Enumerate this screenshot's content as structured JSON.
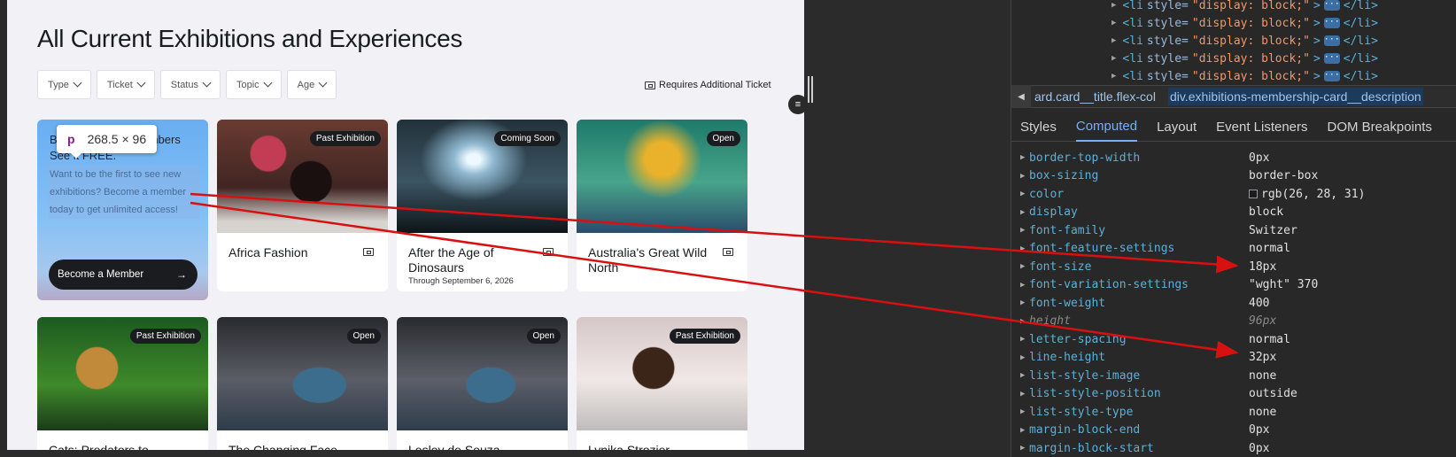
{
  "page": {
    "title": "All Current Exhibitions and Experiences",
    "filters": [
      "Type",
      "Ticket",
      "Status",
      "Topic",
      "Age"
    ],
    "requires_ticket_label": "Requires Additional Ticket"
  },
  "membership": {
    "title": "BE THE FIRST. Members See it FREE.",
    "description": "Want to be the first to see new exhibitions? Become a member today to get unlimited access!",
    "button": "Become a Member",
    "arrow": "→"
  },
  "tooltip": {
    "tag": "p",
    "size": "268.5 × 96"
  },
  "cards": [
    {
      "title": "Africa Fashion",
      "badge": "Past Exhibition",
      "sub": "",
      "ticket": true,
      "image": "africa"
    },
    {
      "title": "After the Age of Dinosaurs",
      "badge": "Coming Soon",
      "sub": "Through September 6, 2026",
      "ticket": true,
      "image": "dino"
    },
    {
      "title": "Australia's Great Wild North",
      "badge": "Open",
      "sub": "",
      "ticket": true,
      "image": "aus"
    },
    {
      "title": "Cats: Predators to",
      "badge": "Past Exhibition",
      "sub": "",
      "ticket": false,
      "image": "cats"
    },
    {
      "title": "The Changing Face",
      "badge": "Open",
      "sub": "",
      "ticket": false,
      "image": "change"
    },
    {
      "title": "Lesley de Souza",
      "badge": "Open",
      "sub": "",
      "ticket": false,
      "image": "lesley"
    },
    {
      "title": "Lynika Strozier",
      "badge": "Past Exhibition",
      "sub": "",
      "ticket": false,
      "image": "lynika"
    }
  ],
  "devtools": {
    "dom_lines": [
      {
        "tag": "<li",
        "attr": "style=",
        "val": "\"display: block;\"",
        "close": "</li>"
      },
      {
        "tag": "<li",
        "attr": "style=",
        "val": "\"display: block;\"",
        "close": "</li>"
      },
      {
        "tag": "<li",
        "attr": "style=",
        "val": "\"display: block;\"",
        "close": "</li>"
      },
      {
        "tag": "<li",
        "attr": "style=",
        "val": "\"display: block;\"",
        "close": "</li>"
      },
      {
        "tag": "<li",
        "attr": "style=",
        "val": "\"display: block;\"",
        "close": "</li>"
      }
    ],
    "breadcrumb": [
      "ard.card__title.flex-col",
      "div.exhibitions-membership-card__description"
    ],
    "tabs": [
      "Styles",
      "Computed",
      "Layout",
      "Event Listeners",
      "DOM Breakpoints"
    ],
    "active_tab": "Computed",
    "properties": [
      {
        "name": "border-top-width",
        "value": "0px"
      },
      {
        "name": "box-sizing",
        "value": "border-box"
      },
      {
        "name": "color",
        "value": "rgb(26, 28, 31)",
        "swatch": "#1a1c1f"
      },
      {
        "name": "display",
        "value": "block"
      },
      {
        "name": "font-family",
        "value": "Switzer"
      },
      {
        "name": "font-feature-settings",
        "value": "normal"
      },
      {
        "name": "font-size",
        "value": "18px"
      },
      {
        "name": "font-variation-settings",
        "value": "\"wght\" 370"
      },
      {
        "name": "font-weight",
        "value": "400"
      },
      {
        "name": "height",
        "value": "96px",
        "italic": true
      },
      {
        "name": "letter-spacing",
        "value": "normal"
      },
      {
        "name": "line-height",
        "value": "32px"
      },
      {
        "name": "list-style-image",
        "value": "none"
      },
      {
        "name": "list-style-position",
        "value": "outside"
      },
      {
        "name": "list-style-type",
        "value": "none"
      },
      {
        "name": "margin-block-end",
        "value": "0px"
      },
      {
        "name": "margin-block-start",
        "value": "0px"
      }
    ]
  },
  "colors": {
    "annotation_arrow": "#e01010",
    "devtools_accent": "#7cacf8"
  }
}
